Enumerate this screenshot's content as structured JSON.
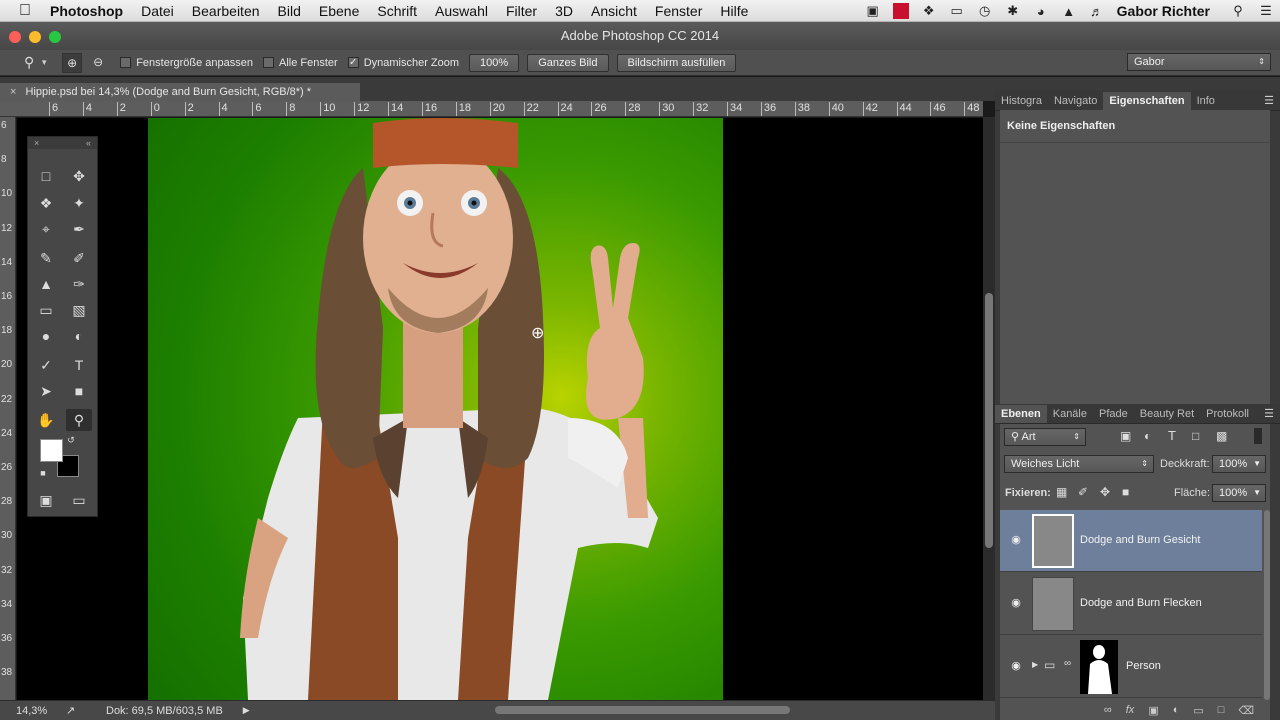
{
  "menubar": {
    "app": "Photoshop",
    "items": [
      "Datei",
      "Bearbeiten",
      "Bild",
      "Ebene",
      "Schrift",
      "Auswahl",
      "Filter",
      "3D",
      "Ansicht",
      "Fenster",
      "Hilfe"
    ],
    "user": "Gabor Richter"
  },
  "window": {
    "title": "Adobe Photoshop CC 2014"
  },
  "options": {
    "fit_window": "Fenstergröße anpassen",
    "all_windows": "Alle Fenster",
    "dynamic_zoom": "Dynamischer Zoom",
    "dynamic_zoom_checked": true,
    "zoom_100": "100%",
    "whole_image": "Ganzes Bild",
    "fill_screen": "Bildschirm ausfüllen",
    "workspace": "Gabor"
  },
  "document": {
    "tab_title": "Hippie.psd bei 14,3% (Dodge and Burn Gesicht, RGB/8*) *",
    "zoom": "14,3%",
    "doc_size": "Dok: 69,5 MB/603,5 MB"
  },
  "rulers": {
    "horizontal": [
      "6",
      "4",
      "2",
      "0",
      "2",
      "4",
      "6",
      "8",
      "10",
      "12",
      "14",
      "16",
      "18",
      "20",
      "22",
      "24",
      "26",
      "28",
      "30",
      "32",
      "34",
      "36",
      "38",
      "40",
      "42",
      "44",
      "46",
      "48"
    ],
    "vertical": [
      "6",
      "8",
      "10",
      "12",
      "14",
      "16",
      "18",
      "20",
      "22",
      "24",
      "26",
      "28",
      "30",
      "32",
      "34",
      "36",
      "38"
    ]
  },
  "properties_panel": {
    "tabs": [
      "Histogra",
      "Navigato",
      "Eigenschaften",
      "Info"
    ],
    "active_tab": "Eigenschaften",
    "message": "Keine Eigenschaften"
  },
  "layers_panel": {
    "tabs": [
      "Ebenen",
      "Kanäle",
      "Pfade",
      "Beauty Ret",
      "Protokoll"
    ],
    "active_tab": "Ebenen",
    "filter": "Art",
    "blend_mode": "Weiches Licht",
    "opacity_label": "Deckkraft:",
    "opacity": "100%",
    "lock_label": "Fixieren:",
    "fill_label": "Fläche:",
    "fill": "100%",
    "layers": [
      {
        "name": "Dodge and Burn Gesicht",
        "selected": true
      },
      {
        "name": "Dodge and Burn Flecken",
        "selected": false
      },
      {
        "name": "Person",
        "selected": false
      }
    ]
  },
  "colors": {
    "selected_layer": "#6d7f9a",
    "panel_bg": "#535353",
    "canvas_bg": "#000000"
  }
}
